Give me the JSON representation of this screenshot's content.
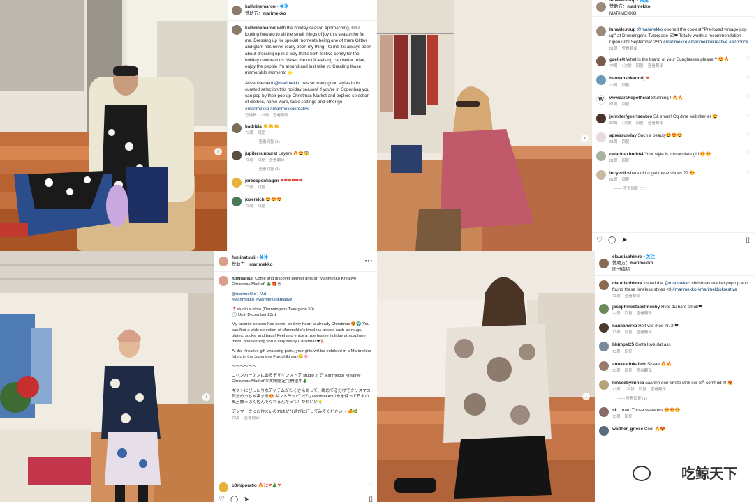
{
  "common": {
    "follow_label": "关注",
    "sponsor_label": "赞助方：",
    "reply_label": "回复",
    "translate_label": "查看翻译",
    "view_replies_1": "查看回复 (1)",
    "ellipsis": "•••"
  },
  "colors": {
    "link": "#0095f6",
    "hashtag": "#00376b"
  },
  "icons": [
    "heart-icon",
    "comment-icon",
    "share-icon",
    "bookmark-icon",
    "chevron-right-icon",
    "more-icon"
  ],
  "post1": {
    "username": "kathrinemaron",
    "dot": "•",
    "sponsor": "marimekko",
    "caption_user": "kathrinemaron",
    "caption_text": "With the holiday season approaching, I'm r looking forward to all the small things of joy this season ho for me. Dressing up for special moments being one of them Glitter and glam has never really been my thing - to me it's always been about dressing up in a way that's both festive comfy for the holiday celebrations. When the outfit feels rig can better relax, enjoy the people I'm around and just take in. Creating those memorable moments",
    "ad_text_1": "Advertisement",
    "ad_mention": "@marimekko",
    "ad_text_2": "has so many good styles in th curated selection this holiday season! If you're in Copenhag you can pop by their pop up Christmas Market and explore selection of clothes, home ware, table settings and other ge",
    "ad_tags": "#marimekko #marimekkokreative",
    "edited": "已编辑",
    "time": "73周",
    "comments": [
      {
        "user": "badrizia",
        "text": "👏👏👏",
        "time": "73周",
        "replies": true
      },
      {
        "user": "jupitersunburst",
        "text": "Layers 🔥😍😱",
        "time": "73周",
        "likes": "",
        "replies": true
      },
      {
        "user": "jorecopenhagen",
        "text": "❤❤❤❤❤❤",
        "time": "73周",
        "replies": false
      },
      {
        "user": "josereich",
        "text": "😍😍😍",
        "time": "73周",
        "replies": false
      }
    ]
  },
  "post2": {
    "username": "lunaklestrup",
    "dot": "•",
    "sponsor": "marimekko",
    "location": "MARIMEKKO",
    "caption_user": "lunaklestrup",
    "caption_mention": "@marimekko",
    "caption_text": "opened the coolest \"Pre-loved vintage pop up\" at Dronningens Tværgade 50❤ Totally worth a recommendation - Open until September 25th",
    "caption_tags": "#marimekko #marimekkokreative #annonce",
    "time": "81周",
    "comments": [
      {
        "user": "gaellett",
        "text": "What is the brand of your Sunglasses please ? 😍🔥",
        "time": "74周",
        "likes": "1次赞",
        "translate": true
      },
      {
        "user": "hannahshkandrij",
        "text": "❤",
        "time": "76周",
        "likes": ""
      },
      {
        "user": "wewearshopofficial",
        "text": "Stunning ! 🔥🔥",
        "time": "81周",
        "likes": ""
      },
      {
        "user": "jenniferfgeertsenbro",
        "text": "Så smuk! Og dine solbriller er 😍",
        "time": "80周",
        "likes": "1次赞",
        "translate": true
      },
      {
        "user": "apressunday",
        "text": "Such a beauty😍😍😍",
        "time": "81周",
        "likes": ""
      },
      {
        "user": "catarinaxbndr64",
        "text": "Your style is immaculate girl 😍😍",
        "time": "81周",
        "likes": ""
      },
      {
        "user": "lucyvoll",
        "text": "where did u get these shoes ?? 😍",
        "time": "81周",
        "likes": "",
        "replies": true
      }
    ]
  },
  "post3": {
    "username": "fuminatsuji",
    "dot": "•",
    "sponsor": "marimekko",
    "caption_user": "fuminatsuji",
    "caption_text": "Come and discover perfect gifts at \"Marimekko Kreative Christmas Market\" 🎄🎁☕",
    "lines": [
      "@marimekko | *Ad",
      "#Marimekko #Marimekkokreative",
      "",
      "📍studio x store (Dronningens Tværgade 50)",
      "🕓 Until December 23rd",
      "",
      "My favorite season has come, and my heart is already Christmas 😍🌍 You can find a wide selection of Marimekko's timeless pieces such as mugs, plates, socks, and bags! Feel and enjoy a true festive holiday atmosphere there, and wishing you a very Merry Christmas❤🦌",
      "",
      "At the Kreative gift-wrapping point, your gifts will be enfolded in a Marimekko fabric in the Japanese Furoshiki way😊🌸",
      "",
      "〜〜〜〜〜〜",
      "",
      "コペンハーゲンにあるデザインストア\"studio x\"で\"Marimekko Kreative Christmas Market\"が期間限定で開催中🎄",
      "",
      "ギフトにぴったりなアイテムがたくさんあって、眺めてるだけでクリスマス気分めっちゃ高まる😍 ギフトラッピングはMarimekkoの布を使って日本の風呂敷っぽく包んでくれるんだって！かわいい💡",
      "",
      "デンマークにお住まいの方はぜひ遊びに行ってみてください〜 🍊🌿"
    ],
    "time": "73周",
    "last_comment": {
      "user": "o0mipora0o",
      "text": "🔥72❤🎄❤"
    }
  },
  "post4": {
    "username": "claudiabhimra",
    "dot": "•",
    "sponsor": "marimekko",
    "location": "图书编组",
    "caption_user": "claudiabhimra",
    "caption_text_1": "visited the",
    "caption_mention": "@marimekko",
    "caption_text_2": "christmas market pop up and found these timeless styles <3",
    "caption_tags": "#marimekko #marimekkokreative",
    "time": "73周",
    "comments": [
      {
        "user": "josephinestabelmonby",
        "text": "Hvor du bare smuk❤",
        "time": "72周",
        "likes": "",
        "translate": true
      },
      {
        "user": "nannamirka",
        "text": "Helt vild med nr. 2!❤",
        "time": "73周",
        "likes": "",
        "translate": true
      },
      {
        "user": "bhimpel25",
        "text": "Gotta love dat ass",
        "time": "73周",
        "likes": ""
      },
      {
        "user": "annakatinkafehr",
        "text": "Skaaat🔥🔥",
        "time": "73周",
        "likes": "",
        "translate": true
      },
      {
        "user": "lensedbylinnea",
        "text": "aaahhh den første strik ser SÅ comf ud !!! 😍",
        "time": "73周",
        "likes": "1次赞",
        "translate": true,
        "replies": true
      },
      {
        "user": "sk...",
        "text": "man Those sweaters 😍😍😍",
        "time": "73周",
        "likes": ""
      },
      {
        "user": "walther_griese",
        "text": "Cool 🔥😍",
        "time": "",
        "likes": ""
      }
    ]
  },
  "watermark": "吃鲸天下"
}
